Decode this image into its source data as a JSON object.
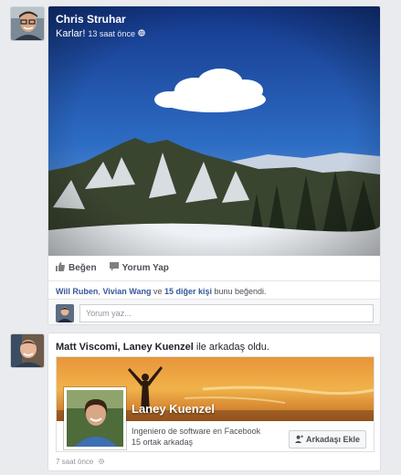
{
  "post1": {
    "author": "Chris Struhar",
    "caption": "Karlar!",
    "time": "13 saat önce",
    "actions": {
      "like": "Beğen",
      "comment": "Yorum Yap"
    },
    "likes": {
      "name1": "Will Ruben",
      "sep1": ", ",
      "name2": "Vivian Wang",
      "sep2": " ve ",
      "others": "15 diğer kişi",
      "suffix": " bunu beğendi."
    },
    "comment_placeholder": "Yorum yaz..."
  },
  "post2": {
    "actor1": "Matt Viscomi",
    "sep": ", ",
    "actor2": "Laney Kuenzel",
    "verb": " ile arkadaş oldu.",
    "friend": {
      "name": "Laney Kuenzel",
      "job": "Ingeniero de software en Facebook",
      "mutual": "15 ortak arkadaş",
      "add_label": "Arkadaşı Ekle"
    },
    "time": "7 saat önce"
  },
  "colors": {
    "link": "#365899",
    "background": "#e9ebee"
  }
}
